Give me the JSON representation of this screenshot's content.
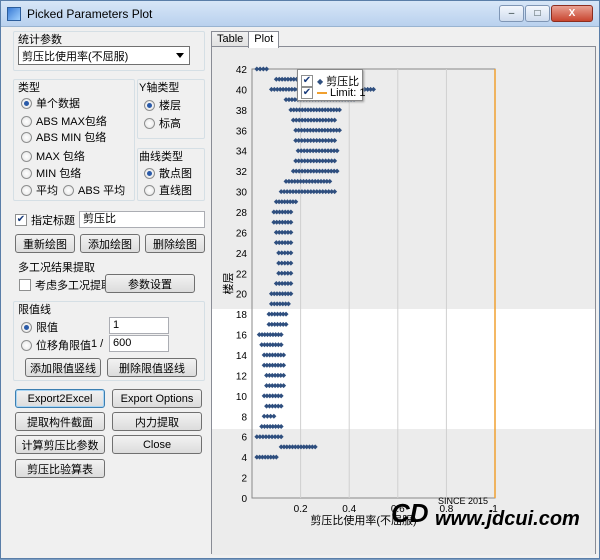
{
  "window": {
    "title": "Picked Parameters Plot",
    "controls": {
      "minimize": "–",
      "maximize": "□",
      "close": "X"
    }
  },
  "stat_param": {
    "group_label": "统计参数",
    "selected": "剪压比使用率(不屈服)"
  },
  "type_group": {
    "label": "类型",
    "options": [
      "单个数据",
      "ABS MAX包络",
      "ABS MIN 包络",
      "MAX 包络",
      "MIN 包络",
      "平均",
      "ABS 平均"
    ],
    "selected_index": 0
  },
  "yaxis_group": {
    "label": "Y轴类型",
    "options": [
      "楼层",
      "标高"
    ],
    "selected_index": 0
  },
  "curve_group": {
    "label": "曲线类型",
    "options": [
      "散点图",
      "直线图"
    ],
    "selected_index": 0
  },
  "title_setting": {
    "checkbox_label": "指定标题",
    "checked": true,
    "value": "剪压比"
  },
  "plot_buttons": [
    "重新绘图",
    "添加绘图",
    "删除绘图"
  ],
  "multi_case": {
    "label": "多工况结果提取",
    "checkbox_label": "考虑多工况提取",
    "checked": false,
    "button": "参数设置"
  },
  "limit": {
    "label": "限值线",
    "option_value_label": "限值",
    "option_value": "1",
    "option_angle_label": "位移角限值",
    "angle_prefix": "1 /",
    "angle_value": "600",
    "selected_index": 0,
    "add_button": "添加限值竖线",
    "delete_button": "删除限值竖线"
  },
  "bottom_buttons": {
    "export_excel": "Export2Excel",
    "export_options": "Export Options",
    "extract_section": "提取构件截面",
    "extract_force": "内力提取",
    "calc_shear": "计算剪压比参数",
    "close": "Close",
    "check_table": "剪压比验算表"
  },
  "tabs": [
    {
      "label": "Table",
      "active": false
    },
    {
      "label": "Plot",
      "active": true
    }
  ],
  "watermark": {
    "since": "SINCE 2015",
    "url": "www.jdcui.com"
  },
  "colors": {
    "marker": "#2f4f7f",
    "limit_line": "#f0a030",
    "band": "#ececec",
    "grid": "#d0d0d0"
  },
  "chart_data": {
    "type": "scatter",
    "xlabel": "剪压比使用率(不屈服)",
    "ylabel": "楼层",
    "xlim": [
      0,
      1
    ],
    "ylim": [
      0,
      42
    ],
    "x_ticks": [
      0.2,
      0.4,
      0.6,
      0.8,
      1
    ],
    "y_ticks": [
      0,
      2,
      4,
      6,
      8,
      10,
      12,
      14,
      16,
      18,
      20,
      22,
      24,
      26,
      28,
      30,
      32,
      34,
      36,
      38,
      40,
      42
    ],
    "legend": {
      "position": "top-right",
      "entries": [
        "剪压比",
        "Limit: 1"
      ]
    },
    "limit_line": 1,
    "series": [
      {
        "name": "剪压比",
        "ranges": [
          [
            42,
            0.02,
            0.06
          ],
          [
            41,
            0.1,
            0.4
          ],
          [
            40,
            0.08,
            0.5
          ],
          [
            39,
            0.14,
            0.42
          ],
          [
            38,
            0.16,
            0.36
          ],
          [
            37,
            0.17,
            0.34
          ],
          [
            36,
            0.18,
            0.36
          ],
          [
            35,
            0.18,
            0.34
          ],
          [
            34,
            0.19,
            0.35
          ],
          [
            33,
            0.18,
            0.34
          ],
          [
            32,
            0.17,
            0.35
          ],
          [
            31,
            0.14,
            0.32
          ],
          [
            30,
            0.12,
            0.34
          ],
          [
            29,
            0.1,
            0.18
          ],
          [
            28,
            0.09,
            0.16
          ],
          [
            27,
            0.09,
            0.16
          ],
          [
            26,
            0.1,
            0.16
          ],
          [
            25,
            0.1,
            0.16
          ],
          [
            24,
            0.11,
            0.16
          ],
          [
            23,
            0.11,
            0.16
          ],
          [
            22,
            0.11,
            0.16
          ],
          [
            21,
            0.1,
            0.16
          ],
          [
            20,
            0.08,
            0.16
          ],
          [
            19,
            0.08,
            0.15
          ],
          [
            18,
            0.07,
            0.14
          ],
          [
            17,
            0.07,
            0.14
          ],
          [
            16,
            0.03,
            0.12
          ],
          [
            15,
            0.04,
            0.12
          ],
          [
            14,
            0.05,
            0.13
          ],
          [
            13,
            0.05,
            0.13
          ],
          [
            12,
            0.06,
            0.13
          ],
          [
            11,
            0.06,
            0.13
          ],
          [
            10,
            0.05,
            0.12
          ],
          [
            9,
            0.06,
            0.12
          ],
          [
            8,
            0.05,
            0.09
          ],
          [
            7,
            0.04,
            0.12
          ],
          [
            6,
            0.02,
            0.12
          ],
          [
            5,
            0.12,
            0.26
          ],
          [
            4,
            0.02,
            0.1
          ]
        ]
      }
    ]
  }
}
